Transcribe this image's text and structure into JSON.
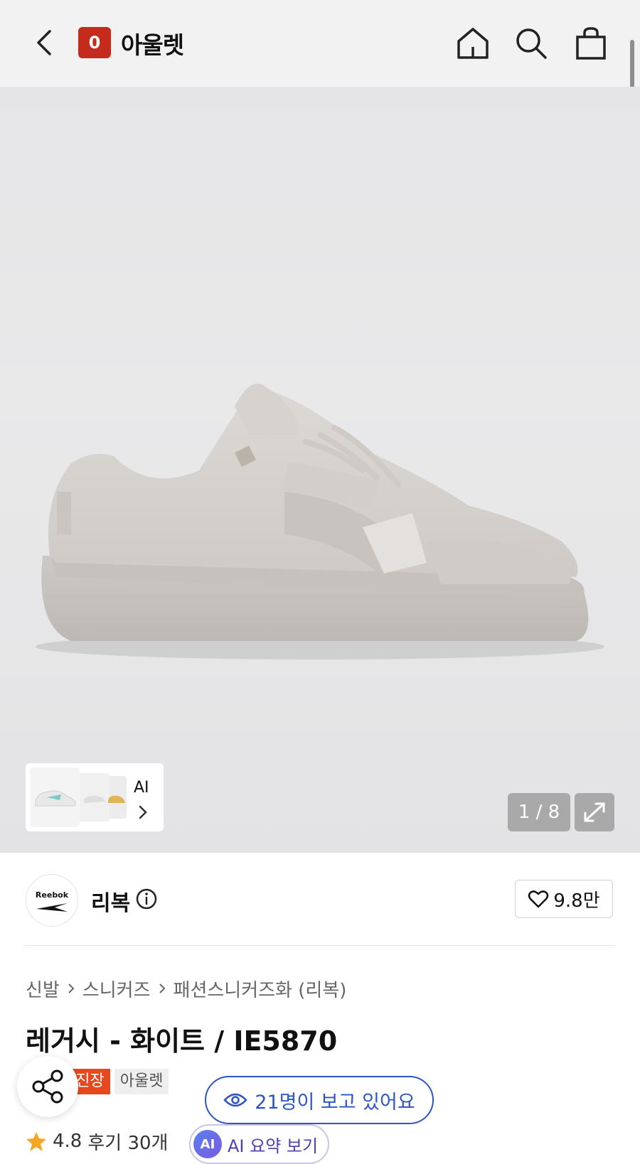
{
  "header": {
    "store_badge": "0",
    "store_name": "아울렛"
  },
  "gallery": {
    "thumbnail_label": "AI",
    "page_counter": "1 / 8"
  },
  "brand": {
    "logo_text": "Reebok",
    "name": "리복",
    "like_count": "9.8만"
  },
  "breadcrumb": [
    "신발",
    "스니커즈",
    "패션스니커즈화 (리복)"
  ],
  "product": {
    "title": "레거시 - 화이트 / IE5870"
  },
  "tags": {
    "tag1": "무진장",
    "tag2": "아울렛"
  },
  "viewers": "21명이 보고 있어요",
  "reviews": {
    "rating": "4.8",
    "count": "후기 30개"
  },
  "ai_summary": {
    "badge": "AI",
    "label": "AI 요약 보기"
  },
  "colors": {
    "brand_red": "#c42b1c",
    "tag_red": "#e8481e",
    "viewer_blue": "#2d55c4",
    "star_orange": "#f5a623"
  }
}
